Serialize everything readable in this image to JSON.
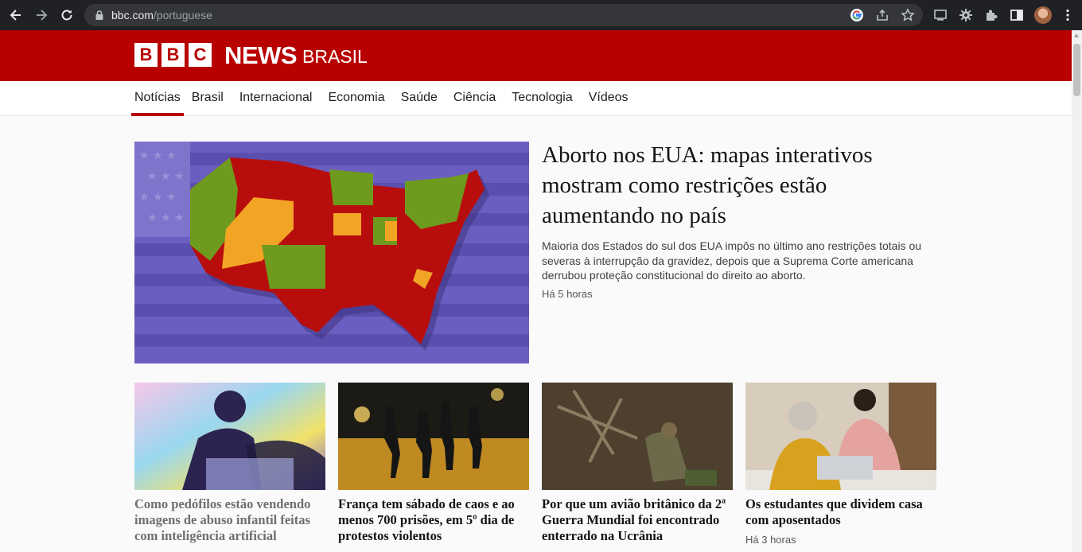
{
  "browser": {
    "url_host": "bbc.com",
    "url_path": "/portuguese",
    "icons": [
      "back-icon",
      "forward-icon",
      "reload-icon",
      "lock-icon",
      "google-icon",
      "share-icon",
      "bookmark-star-icon",
      "cast-icon",
      "gear-extension-icon",
      "puzzle-extensions-icon",
      "side-panel-icon",
      "profile-avatar",
      "kebab-menu-icon"
    ]
  },
  "masthead": {
    "bbc_letters": [
      "B",
      "B",
      "C"
    ],
    "news": "NEWS",
    "edition": "BRASIL",
    "brand_color": "#b80000"
  },
  "nav": {
    "items": [
      "Notícias",
      "Brasil",
      "Internacional",
      "Economia",
      "Saúde",
      "Ciência",
      "Tecnologia",
      "Vídeos"
    ],
    "active": "Notícias"
  },
  "hero": {
    "title": "Aborto nos EUA: mapas interativos mostram como restrições estão aumentando no país",
    "summary": "Maioria dos Estados do sul dos EUA impôs no último ano restrições totais ou severas à interrupção da gravidez, depois que a Suprema Corte americana derrubou proteção constitucional do direito ao aborto.",
    "time": "Há 5 horas"
  },
  "cards": [
    {
      "title": "Como pedófilos estão vendendo imagens de abuso infantil feitas com inteligência artificial",
      "time": ""
    },
    {
      "title": "França tem sábado de caos e ao menos 700 prisões, em 5º dia de protestos violentos",
      "time": ""
    },
    {
      "title": "Por que um avião britânico da 2ª Guerra Mundial foi encontrado enterrado na Ucrânia",
      "time": ""
    },
    {
      "title": "Os estudantes que dividem casa com aposentados",
      "time": "Há 3 horas"
    }
  ]
}
